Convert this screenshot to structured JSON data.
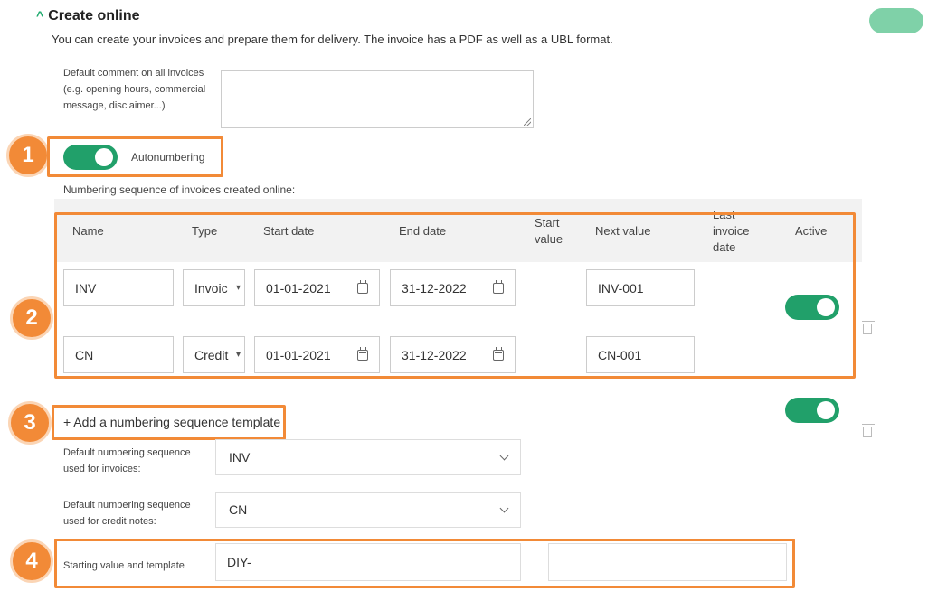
{
  "section": {
    "title": "Create online",
    "subtitle": "You can create your invoices and prepare them for delivery. The invoice has a PDF as well as a UBL format."
  },
  "default_comment": {
    "label_line1": "Default comment on all invoices",
    "label_line2": "(e.g. opening hours, commercial",
    "label_line3": "message, disclaimer...)",
    "value": ""
  },
  "autonumbering": {
    "label": "Autonumbering",
    "enabled": true
  },
  "sequence_heading": "Numbering sequence of invoices created online:",
  "table": {
    "headers": {
      "name": "Name",
      "type": "Type",
      "start_date": "Start date",
      "end_date": "End date",
      "start_value_1": "Start",
      "start_value_2": "value",
      "next_value": "Next value",
      "last_invoice_1": "Last",
      "last_invoice_2": "invoice",
      "last_invoice_3": "date",
      "active": "Active"
    },
    "rows": [
      {
        "name": "INV",
        "type": "Invoic",
        "start_date": "01-01-2021",
        "end_date": "31-12-2022",
        "start_value": "",
        "next_value": "INV-001",
        "last_invoice_date": "",
        "active": true
      },
      {
        "name": "CN",
        "type": "Credit",
        "start_date": "01-01-2021",
        "end_date": "31-12-2022",
        "start_value": "",
        "next_value": "CN-001",
        "last_invoice_date": "",
        "active": true
      }
    ]
  },
  "add_template_label": "+ Add a numbering sequence template",
  "default_invoices": {
    "label_line1": "Default numbering sequence",
    "label_line2": "used for invoices:",
    "value": "INV"
  },
  "default_credit": {
    "label_line1": "Default numbering sequence",
    "label_line2": "used for credit notes:",
    "value": "CN"
  },
  "starting_value": {
    "label": "Starting value and template",
    "value": "DIY-",
    "template_value": ""
  },
  "callouts": [
    "1",
    "2",
    "3",
    "4"
  ],
  "colors": {
    "accent_green": "#21a06a",
    "callout_orange": "#f28a37",
    "header_gray": "#f2f2f2"
  }
}
